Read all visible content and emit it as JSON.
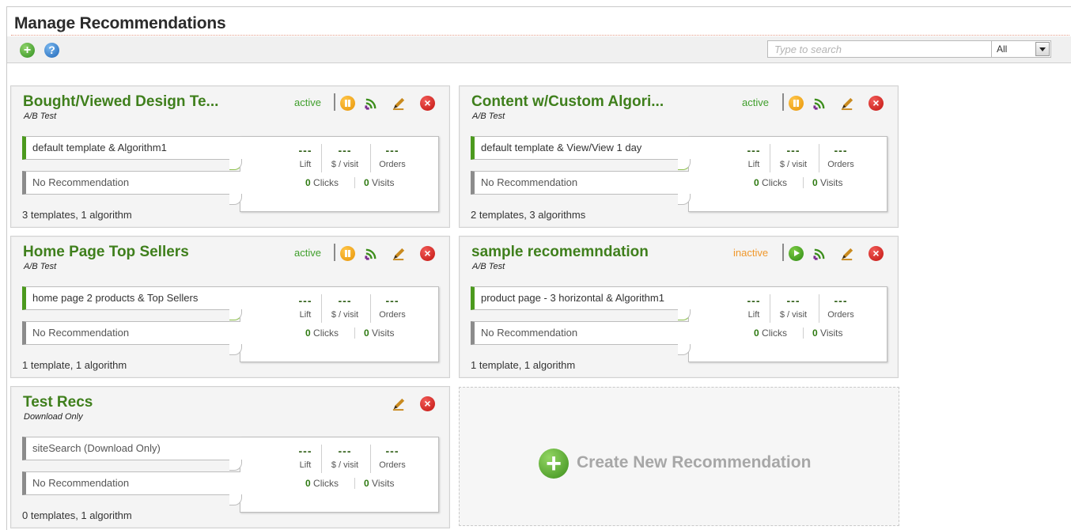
{
  "page": {
    "title": "Manage Recommendations"
  },
  "toolbar": {
    "add_icon": "add-circle-icon",
    "help_icon": "help-circle-icon",
    "search_placeholder": "Type to search",
    "filter_value": "All"
  },
  "colors": {
    "accent_green": "#3f7f1c",
    "status_active": "#3f9e2b",
    "status_inactive": "#f0982c",
    "delete_red": "#d3211b"
  },
  "cards": [
    {
      "title": "Bought/Viewed Design Te...",
      "type": "A/B Test",
      "status": "active",
      "primary": "default template & Algorithm1",
      "secondary": "No Recommendation",
      "lift": "---",
      "per_visit": "---",
      "orders": "---",
      "lift_label": "Lift",
      "per_visit_label": "$ / visit",
      "orders_label": "Orders",
      "clicks": "0",
      "clicks_label": "Clicks",
      "visits": "0",
      "visits_label": "Visits",
      "footer": "3 templates, 1 algorithm"
    },
    {
      "title": "Content w/Custom Algori...",
      "type": "A/B Test",
      "status": "active",
      "primary": "default template & View/View 1 day",
      "secondary": "No Recommendation",
      "lift": "---",
      "per_visit": "---",
      "orders": "---",
      "lift_label": "Lift",
      "per_visit_label": "$ / visit",
      "orders_label": "Orders",
      "clicks": "0",
      "clicks_label": "Clicks",
      "visits": "0",
      "visits_label": "Visits",
      "footer": "2 templates, 3 algorithms"
    },
    {
      "title": "Home Page Top Sellers",
      "type": "A/B Test",
      "status": "active",
      "primary": "home page 2 products & Top Sellers",
      "secondary": "No Recommendation",
      "lift": "---",
      "per_visit": "---",
      "orders": "---",
      "lift_label": "Lift",
      "per_visit_label": "$ / visit",
      "orders_label": "Orders",
      "clicks": "0",
      "clicks_label": "Clicks",
      "visits": "0",
      "visits_label": "Visits",
      "footer": "1 template, 1 algorithm"
    },
    {
      "title": "sample recomemndation",
      "type": "A/B Test",
      "status": "inactive",
      "primary": "product page - 3 horizontal & Algorithm1",
      "secondary": "No Recommendation",
      "lift": "---",
      "per_visit": "---",
      "orders": "---",
      "lift_label": "Lift",
      "per_visit_label": "$ / visit",
      "orders_label": "Orders",
      "clicks": "0",
      "clicks_label": "Clicks",
      "visits": "0",
      "visits_label": "Visits",
      "footer": "1 template, 1 algorithm"
    },
    {
      "title": "Test Recs",
      "type": "Download Only",
      "status": "",
      "primary": "siteSearch (Download Only)",
      "secondary": "No Recommendation",
      "lift": "---",
      "per_visit": "---",
      "orders": "---",
      "lift_label": "Lift",
      "per_visit_label": "$ / visit",
      "orders_label": "Orders",
      "clicks": "0",
      "clicks_label": "Clicks",
      "visits": "0",
      "visits_label": "Visits",
      "footer": "0 templates, 1 algorithm"
    }
  ],
  "create": {
    "label": "Create New Recommendation",
    "icon": "add-circle-icon"
  }
}
